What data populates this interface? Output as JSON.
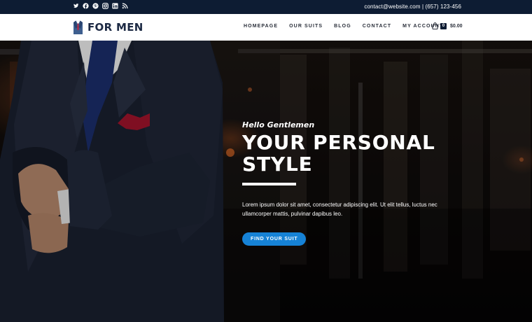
{
  "topbar": {
    "socials": [
      {
        "name": "twitter-icon"
      },
      {
        "name": "facebook-icon"
      },
      {
        "name": "pinterest-icon"
      },
      {
        "name": "instagram-icon"
      },
      {
        "name": "linkedin-icon"
      },
      {
        "name": "rss-icon"
      }
    ],
    "contact": "contact@website.com | (657) 123-456"
  },
  "header": {
    "logo_text": "FOR MEN",
    "nav": [
      {
        "label": "HOMEPAGE"
      },
      {
        "label": "OUR SUITS"
      },
      {
        "label": "BLOG"
      },
      {
        "label": "CONTACT"
      },
      {
        "label": "MY ACCOUNT"
      }
    ],
    "cart": {
      "count": "0",
      "total": "$0.00",
      "icon": "shopping-bag-icon"
    }
  },
  "hero": {
    "greeting": "Hello Gentlemen",
    "headline_line1": "YOUR PERSONAL",
    "headline_line2": "STYLE",
    "body": "Lorem ipsum dolor sit amet, consectetur adipiscing elit. Ut elit tellus, luctus nec ullamcorper mattis, pulvinar dapibus leo.",
    "cta": "FIND YOUR SUIT"
  },
  "colors": {
    "topbar_bg": "#0d1c33",
    "accent": "#1682d6",
    "brand_navy": "#1d2a44"
  }
}
